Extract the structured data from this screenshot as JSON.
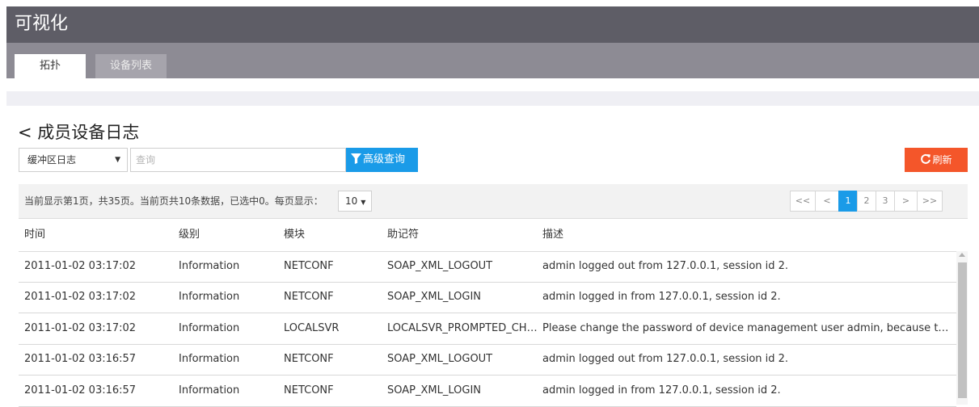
{
  "app": {
    "title": "可视化"
  },
  "tabs": [
    {
      "label": "拓扑"
    },
    {
      "label": "设备列表"
    }
  ],
  "page": {
    "title": "< 成员设备日志"
  },
  "toolbar": {
    "log_type": "缓冲区日志",
    "search_placeholder": "查询",
    "advanced_query": "高级查询",
    "refresh": "刷新"
  },
  "info": {
    "text": "当前显示第1页，共35页。当前页共10条数据，已选中0。每页显示：",
    "page_size": "10"
  },
  "pagination": {
    "first": "<<",
    "prev": "<",
    "pages": [
      "1",
      "2",
      "3"
    ],
    "current": "1",
    "next": ">",
    "last": ">>"
  },
  "colors": {
    "accent": "#1a9be8",
    "refresh": "#f4562a",
    "header": "#5e5d66"
  },
  "table": {
    "columns": [
      "时间",
      "级别",
      "模块",
      "助记符",
      "描述"
    ],
    "rows": [
      [
        "2011-01-02 03:17:02",
        "Information",
        "NETCONF",
        "SOAP_XML_LOGOUT",
        "admin logged out from 127.0.0.1, session id 2."
      ],
      [
        "2011-01-02 03:17:02",
        "Information",
        "NETCONF",
        "SOAP_XML_LOGIN",
        "admin logged in from 127.0.0.1, session id 2."
      ],
      [
        "2011-01-02 03:17:02",
        "Information",
        "LOCALSVR",
        "LOCALSVR_PROMPTED_CHA...",
        "Please change the password of device management user admin, because the curre..."
      ],
      [
        "2011-01-02 03:16:57",
        "Information",
        "NETCONF",
        "SOAP_XML_LOGOUT",
        "admin logged out from 127.0.0.1, session id 2."
      ],
      [
        "2011-01-02 03:16:57",
        "Information",
        "NETCONF",
        "SOAP_XML_LOGIN",
        "admin logged in from 127.0.0.1, session id 2."
      ]
    ]
  }
}
